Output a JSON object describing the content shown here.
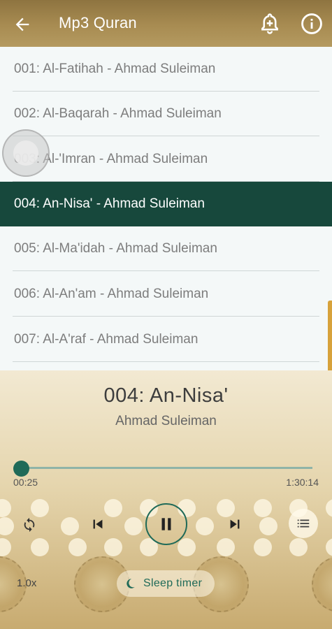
{
  "app": {
    "title": "Mp3 Quran",
    "accent": "#17483c",
    "header_color": "#a88c52"
  },
  "header": {
    "back_icon": "arrow-left-icon",
    "bell_icon": "bell-plus-icon",
    "info_icon": "info-icon"
  },
  "tracks": [
    {
      "label": "001: Al-Fatihah - Ahmad Suleiman"
    },
    {
      "label": "002: Al-Baqarah - Ahmad Suleiman"
    },
    {
      "label": "003: Al-'Imran - Ahmad Suleiman"
    },
    {
      "label": "004: An-Nisa' - Ahmad Suleiman",
      "active": true
    },
    {
      "label": "005: Al-Ma'idah - Ahmad Suleiman"
    },
    {
      "label": "006: Al-An'am - Ahmad Suleiman"
    },
    {
      "label": "007: Al-A'raf - Ahmad Suleiman"
    }
  ],
  "player": {
    "title": "004: An-Nisa'",
    "artist": "Ahmad Suleiman",
    "current_time": "00:25",
    "total_time": "1:30:14",
    "progress": 0.005,
    "speed": "1.0x",
    "sleep_label": "Sleep timer",
    "state": "playing"
  }
}
